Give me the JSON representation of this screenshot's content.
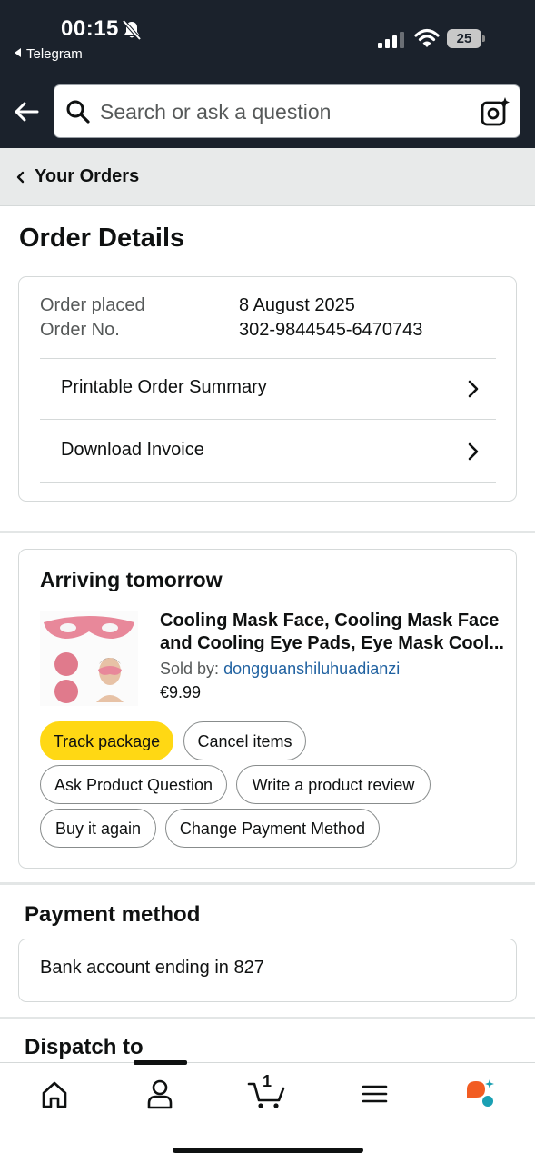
{
  "status_bar": {
    "time": "00:15",
    "back_app": "Telegram",
    "battery": "25"
  },
  "search": {
    "placeholder": "Search or ask a question"
  },
  "breadcrumb": {
    "label": "Your Orders"
  },
  "page": {
    "title": "Order Details"
  },
  "order": {
    "placed_label": "Order placed",
    "placed_value": "8 August 2025",
    "number_label": "Order No.",
    "number_value": "302-9844545-6470743",
    "links": [
      {
        "label": "Printable Order Summary"
      },
      {
        "label": "Download Invoice"
      }
    ]
  },
  "shipment": {
    "status": "Arriving tomorrow",
    "product_line1": "Cooling Mask Face, Cooling Mask Face",
    "product_line2": "and Cooling Eye Pads, Eye Mask Cool...",
    "sold_by_label": "Sold by:",
    "seller": "dongguanshiluhuadianzi",
    "price": "€9.99",
    "actions": {
      "track": "Track package",
      "cancel": "Cancel items",
      "ask": "Ask Product Question",
      "review": "Write a product review",
      "buy_again": "Buy it again",
      "change_payment": "Change Payment Method"
    }
  },
  "payment": {
    "title": "Payment method",
    "text": "Bank account ending in 827"
  },
  "dispatch": {
    "title": "Dispatch to"
  },
  "bottom_nav": {
    "cart_count": "1",
    "items": [
      "home-icon",
      "account-icon",
      "cart-icon",
      "menu-icon",
      "rufus-assistant-icon"
    ]
  },
  "colors": {
    "header_bg": "#1b222c",
    "accent_yellow": "#ffd814",
    "link_blue": "#2162a1",
    "product_pink": "#e07a8c"
  }
}
